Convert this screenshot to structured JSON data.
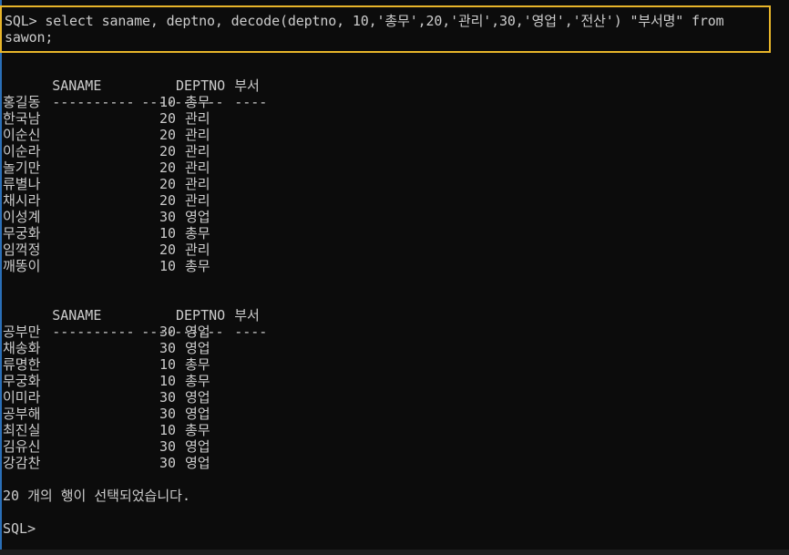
{
  "command": {
    "line1": "SQL> select saname, deptno, decode(deptno, 10,'총무',20,'관리',30,'영업','전산') \"부서명\" from",
    "line2": "sawon;"
  },
  "headers": {
    "col1": "SANAME",
    "col2": "DEPTNO",
    "col3": "부서",
    "rule1": "----------",
    "rule2": "----------",
    "rule3": "----"
  },
  "page1": [
    {
      "name": "홍길동",
      "deptno": "10",
      "dept": "총무"
    },
    {
      "name": "한국남",
      "deptno": "20",
      "dept": "관리"
    },
    {
      "name": "이순신",
      "deptno": "20",
      "dept": "관리"
    },
    {
      "name": "이순라",
      "deptno": "20",
      "dept": "관리"
    },
    {
      "name": "놀기만",
      "deptno": "20",
      "dept": "관리"
    },
    {
      "name": "류별나",
      "deptno": "20",
      "dept": "관리"
    },
    {
      "name": "채시라",
      "deptno": "20",
      "dept": "관리"
    },
    {
      "name": "이성계",
      "deptno": "30",
      "dept": "영업"
    },
    {
      "name": "무궁화",
      "deptno": "10",
      "dept": "총무"
    },
    {
      "name": "임꺽정",
      "deptno": "20",
      "dept": "관리"
    },
    {
      "name": "깨똥이",
      "deptno": "10",
      "dept": "총무"
    }
  ],
  "page2": [
    {
      "name": "공부만",
      "deptno": "30",
      "dept": "영업"
    },
    {
      "name": "채송화",
      "deptno": "30",
      "dept": "영업"
    },
    {
      "name": "류명한",
      "deptno": "10",
      "dept": "총무"
    },
    {
      "name": "무궁화",
      "deptno": "10",
      "dept": "총무"
    },
    {
      "name": "이미라",
      "deptno": "30",
      "dept": "영업"
    },
    {
      "name": "공부해",
      "deptno": "30",
      "dept": "영업"
    },
    {
      "name": "최진실",
      "deptno": "10",
      "dept": "총무"
    },
    {
      "name": "김유신",
      "deptno": "30",
      "dept": "영업"
    },
    {
      "name": "강감찬",
      "deptno": "30",
      "dept": "영업"
    }
  ],
  "summary": "20 개의 행이 선택되었습니다.",
  "prompt": "SQL>",
  "colors": {
    "background": "#0c0c0c",
    "text": "#cccccc",
    "highlight_border": "#e8b52a"
  }
}
